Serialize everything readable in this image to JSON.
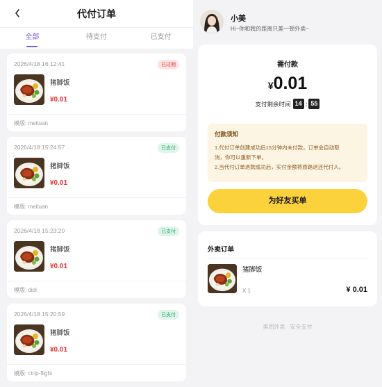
{
  "header": {
    "title": "代付订单"
  },
  "tabs": [
    {
      "label": "全部",
      "active": true
    },
    {
      "label": "待支付",
      "active": false
    },
    {
      "label": "已支付",
      "active": false
    }
  ],
  "orders": [
    {
      "time": "2026/4/18 16:12:41",
      "status": "已过期",
      "status_type": "expired",
      "name": "猪脚饭",
      "price": "¥0.01",
      "template": "模版: meituan"
    },
    {
      "time": "2026/4/18 15:24:57",
      "status": "已支付",
      "status_type": "paid",
      "name": "猪脚饭",
      "price": "¥0.01",
      "template": "模版: meituan"
    },
    {
      "time": "2026/4/18 15:23:20",
      "status": "已支付",
      "status_type": "paid",
      "name": "猪脚饭",
      "price": "¥0.01",
      "template": "模版: didi"
    },
    {
      "time": "2026/4/18 15:20:59",
      "status": "已支付",
      "status_type": "paid",
      "name": "猪脚饭",
      "price": "¥0.01",
      "template": "模版: ctrip-flight"
    }
  ],
  "user": {
    "name": "小美",
    "subtitle": "Hi~你和我的距离只差一顿外卖~"
  },
  "payment": {
    "label": "需付款",
    "currency": "¥",
    "amount": "0.01",
    "timer_label": "支付剩余时间",
    "minutes": "14",
    "seconds": "55"
  },
  "notice": {
    "title": "付款须知",
    "line1": "1.代付订单创建成功后15分钟内未付款，订单会自动取",
    "line2": "消，你可以重新下单。",
    "line3": "2.当代付订单退款成功后，实付金额将原路退还代付人。"
  },
  "buy_button": {
    "label": "为好友买单"
  },
  "takeout": {
    "title": "外卖订单",
    "item_name": "猪脚饭",
    "qty": "X 1",
    "price": "¥ 0.01"
  },
  "footer": {
    "text": "美团外卖 · 安全支付"
  },
  "colors": {
    "accent": "#6b5ce7",
    "price_red": "#e8332f",
    "button_yellow": "#fcd23c",
    "paid_green": "#23a86a",
    "expired_red": "#e23b3b"
  }
}
